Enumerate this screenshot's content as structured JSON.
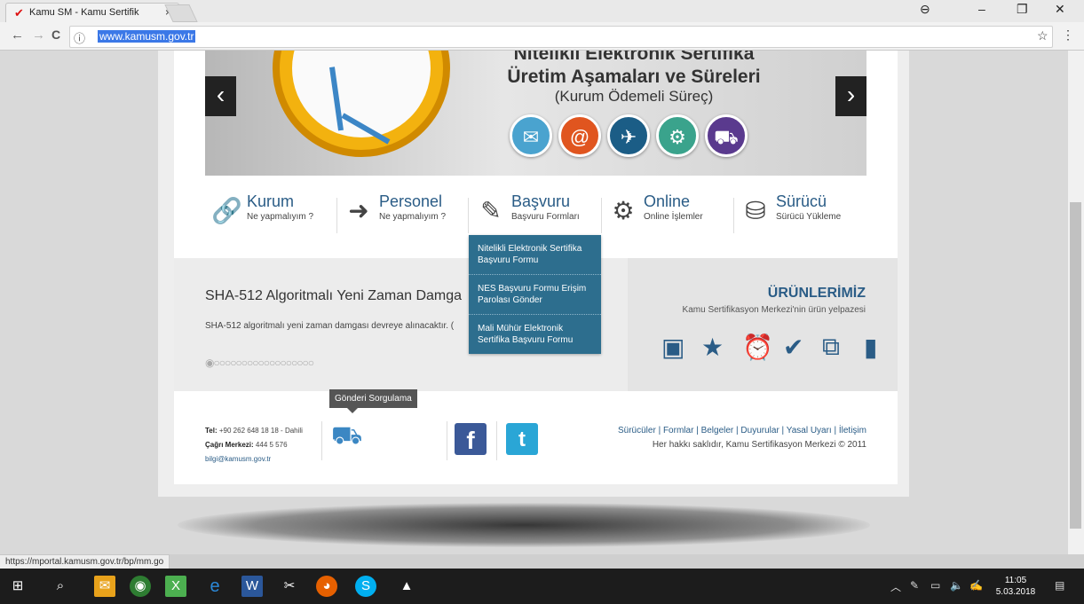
{
  "browser": {
    "tab_title": "Kamu SM - Kamu Sertifik",
    "tab_close": "×",
    "url": "www.kamusm.gov.tr",
    "status_url": "https://mportal.kamusm.gov.tr/bp/mm.go"
  },
  "banner": {
    "title_line1": "Nitelikli Elektronik Sertifika",
    "title_line2": "Üretim Aşamaları ve Süreleri",
    "subtitle": "(Kurum Ödemeli Süreç)",
    "prev": "‹",
    "next": "›"
  },
  "nav": [
    {
      "title": "Kurum",
      "sub": "Ne yapmalıyım ?"
    },
    {
      "title": "Personel",
      "sub": "Ne yapmalıyım ?"
    },
    {
      "title": "Başvuru",
      "sub": "Başvuru Formları"
    },
    {
      "title": "Online",
      "sub": "Online İşlemler"
    },
    {
      "title": "Sürücü",
      "sub": "Sürücü Yükleme"
    }
  ],
  "dropdown": [
    "Nitelikli Elektronik Sertifika Başvuru Formu",
    "NES Başvuru Formu Erişim Parolası Gönder",
    "Mali Mühür Elektronik Sertifika Başvuru Formu"
  ],
  "news": {
    "title": "SHA-512 Algoritmalı Yeni Zaman Damga",
    "text": "SHA-512 algoritmalı yeni zaman damgası devreye alınacaktır. (",
    "dots": "◉○○○○○○○○○○○○○○○○○○"
  },
  "products": {
    "title": "ÜRÜNLERİMİZ",
    "subtitle": "Kamu Sertifikasyon Merkezi'nin ürün yelpazesi"
  },
  "footer": {
    "tel_label": "Tel:",
    "tel_value": "+90 262 648 18 18 - Dahili",
    "call_label": "Çağrı Merkezi:",
    "call_value": "444 5 576",
    "email": "bilgi@kamusm.gov.tr",
    "tooltip": "Gönderi Sorgulama",
    "fb": "f",
    "tw": "t",
    "links": [
      "Sürücüler",
      "Formlar",
      "Belgeler",
      "Duyurular",
      "Yasal Uyarı",
      "İletişim"
    ],
    "copyright": "Her hakkı saklıdır, Kamu Sertifikasyon Merkezi © 2011"
  },
  "taskbar": {
    "time": "11:05",
    "date": "5.03.2018"
  },
  "colors": {
    "accent": "#2a5c86",
    "dropdown_bg": "#2d6e8e"
  }
}
